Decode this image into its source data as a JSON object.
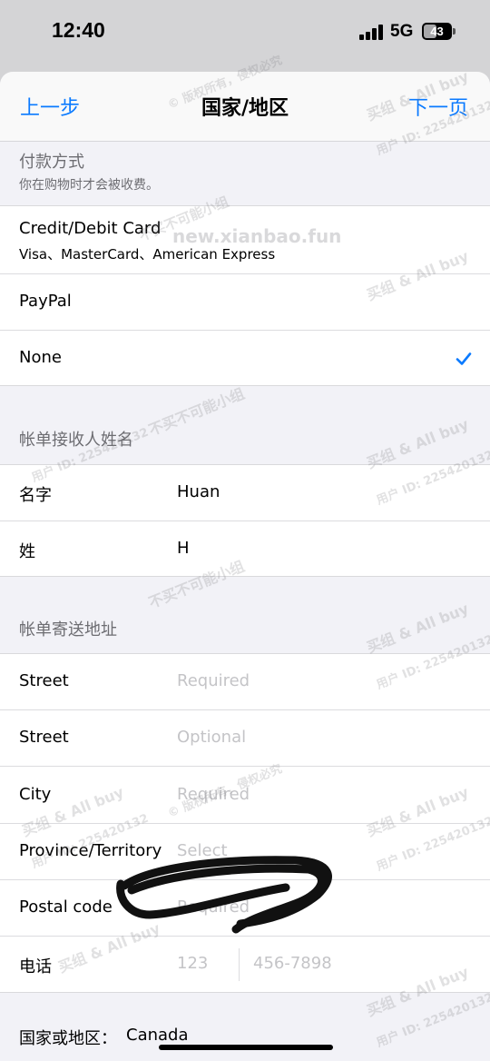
{
  "status_bar": {
    "time": "12:40",
    "network": "5G",
    "battery": "43"
  },
  "nav": {
    "back_label": "上一步",
    "title": "国家/地区",
    "next_label": "下一页"
  },
  "payment": {
    "header_title": "付款方式",
    "header_sub": "你在购物时才会被收费。",
    "options": [
      {
        "label": "Credit/Debit Card",
        "sub": "Visa、MasterCard、American Express",
        "selected": false
      },
      {
        "label": "PayPal",
        "selected": false
      },
      {
        "label": "None",
        "selected": true
      }
    ]
  },
  "billing_name": {
    "header_title": "帐单接收人姓名",
    "fields": [
      {
        "label": "名字",
        "value": "Huan"
      },
      {
        "label": "姓",
        "value": "H"
      }
    ]
  },
  "billing_address": {
    "header_title": "帐单寄送地址",
    "fields": [
      {
        "label": "Street",
        "placeholder": "Required"
      },
      {
        "label": "Street",
        "placeholder": "Optional"
      },
      {
        "label": "City",
        "placeholder": "Required"
      },
      {
        "label": "Province/Territory",
        "placeholder": "Select"
      },
      {
        "label": "Postal code",
        "placeholder": "Required"
      }
    ],
    "phone": {
      "label": "电话",
      "area_placeholder": "123",
      "number_placeholder": "456-7898"
    }
  },
  "country": {
    "label": "国家或地区：",
    "value": "Canada"
  },
  "watermarks": [
    "买组 & All buy",
    "用户 ID: 225420132",
    "© 版权所有，侵权必究",
    "不买不可能小组",
    "new.xianbao.fun"
  ],
  "colors": {
    "accent": "#0a7aff",
    "placeholder": "#c4c4c7",
    "background": "#f2f2f7"
  }
}
